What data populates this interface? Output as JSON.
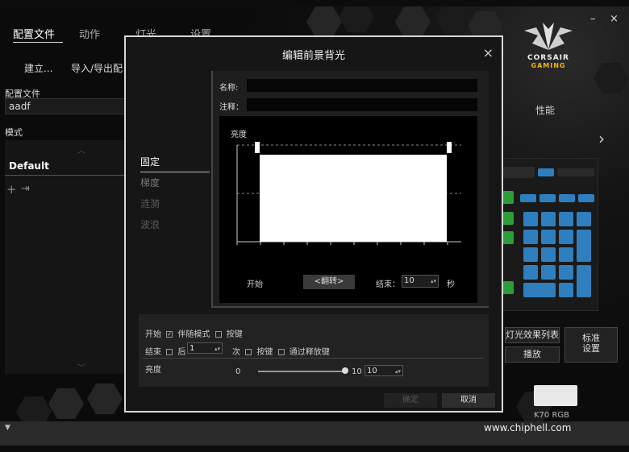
{
  "window": {
    "tabs": [
      {
        "label": "配置文件"
      },
      {
        "label": "动作"
      },
      {
        "label": "灯光"
      },
      {
        "label": "设置"
      }
    ],
    "minimize": "–",
    "close": "×",
    "subtabs": {
      "create": "建立...",
      "import_export": "导入/导出配"
    }
  },
  "sidebar": {
    "profile_label": "配置文件",
    "profile_value": "aadf",
    "mode_label": "模式",
    "mode_item": "Default",
    "add_icon": "plus-icon",
    "export_icon": "export-icon"
  },
  "brand": {
    "line1": "CORSAIR",
    "line2": "GAMING",
    "accent": "#f2b705"
  },
  "right_panel": {
    "perf_label": "性能",
    "next_arrow": "›",
    "effect_list": "灯光效果列表",
    "play": "播放",
    "standard_settings": "标准\n设置",
    "device": "K70 RGB"
  },
  "dialog": {
    "title": "编辑前景背光",
    "close": "×",
    "tabs": [
      {
        "label": "固定",
        "state": "active"
      },
      {
        "label": "梯度",
        "state": "normal"
      },
      {
        "label": "涟漪",
        "state": "dim"
      },
      {
        "label": "波浪",
        "state": "dim"
      }
    ],
    "name_label": "名称:",
    "note_label": "注释：",
    "graph": {
      "title": "亮度",
      "start_label": "开始",
      "flip_button": "<翻转>",
      "end_label": "结束：",
      "end_value": "10",
      "unit": "秒",
      "level": 0.9
    },
    "start_row": {
      "label": "开始",
      "follow_mode": "伴随模式",
      "follow_checked": true,
      "key": "按键"
    },
    "end_row": {
      "label": "结束",
      "after": "后",
      "times_value": "1",
      "times_unit": "次",
      "key": "按键",
      "release": "通过释放键"
    },
    "brightness": {
      "label": "亮度",
      "min": "0",
      "max": "10",
      "value": "10",
      "fraction": 1.0
    },
    "ok": "确定",
    "cancel": "取消"
  },
  "watermark": "www.chiphell.com"
}
